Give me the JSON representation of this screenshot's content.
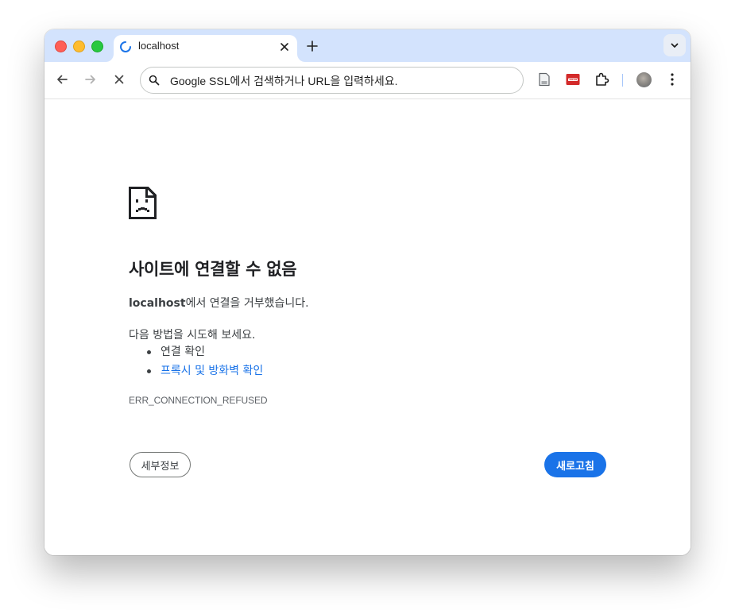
{
  "browser": {
    "tab": {
      "title": "localhost",
      "close_icon": "close-icon",
      "loading_icon": "loading-spinner-icon"
    },
    "new_tab_icon": "plus-icon",
    "tab_search_icon": "chevron-down-icon",
    "toolbar": {
      "back_icon": "back-arrow-icon",
      "forward_icon": "forward-arrow-icon",
      "stop_icon": "stop-x-icon",
      "omnibox": {
        "icon": "search-icon",
        "placeholder": "Google SSL에서 검색하거나 URL을 입력하세요."
      },
      "extensions": [
        "page-icon",
        "password-manager-extension-icon",
        "puzzle-extensions-icon"
      ],
      "menu_icon": "more-vert-icon"
    }
  },
  "error_page": {
    "icon": "sad-page-icon",
    "title": "사이트에 연결할 수 없음",
    "summary_host": "localhost",
    "summary_rest": "에서 연결을 거부했습니다.",
    "suggestions_heading": "다음 방법을 시도해 보세요.",
    "suggestions": [
      {
        "label": "연결 확인"
      },
      {
        "label": "프록시 및 방화벽 확인"
      }
    ],
    "error_code": "ERR_CONNECTION_REFUSED",
    "details_button": "세부정보",
    "reload_button": "새로고침"
  },
  "colors": {
    "tabstrip": "#d3e3fd",
    "accent": "#1a73e8",
    "link": "#1a73e8",
    "traffic_red": "#ff5f57",
    "traffic_yellow": "#febc2e",
    "traffic_green": "#28c840"
  }
}
